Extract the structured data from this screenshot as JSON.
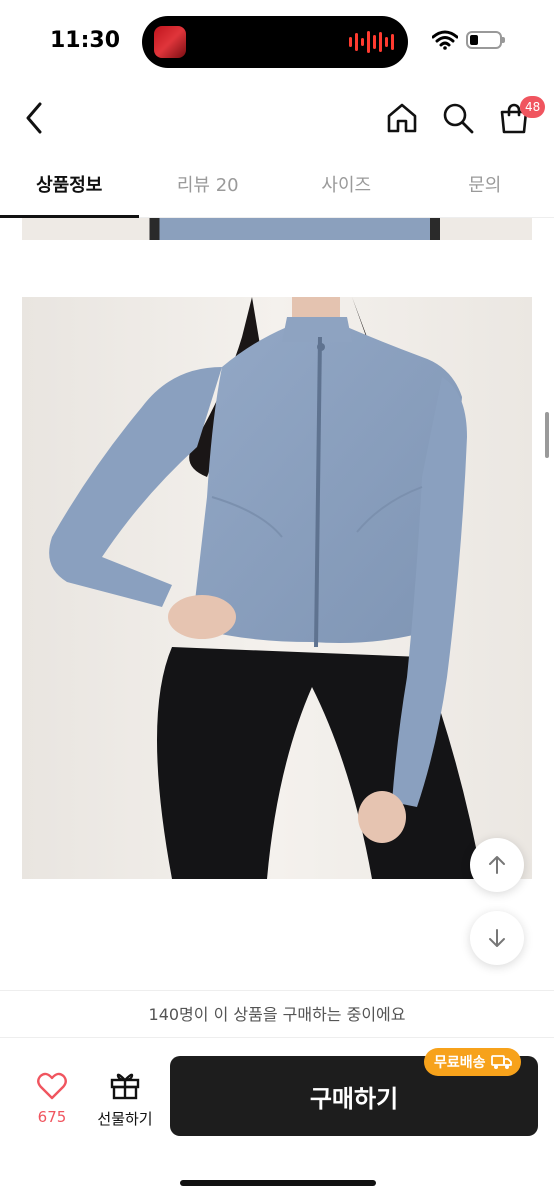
{
  "status_bar": {
    "time": "11:30",
    "icons": [
      "now-playing-artwork",
      "audio-wave-icon",
      "wifi-icon",
      "battery-icon"
    ]
  },
  "nav": {
    "icons": [
      "back-chevron-icon",
      "home-icon",
      "search-icon",
      "shopping-bag-icon"
    ],
    "cart_count": "48"
  },
  "tabs": [
    {
      "label": "상품정보",
      "active": true
    },
    {
      "label": "리뷰 20",
      "active": false
    },
    {
      "label": "사이즈",
      "active": false
    },
    {
      "label": "문의",
      "active": false
    }
  ],
  "floating": {
    "icons": [
      "arrow-up-icon",
      "arrow-down-icon"
    ]
  },
  "purchase_notice": "140명이 이 상품을 구매하는 중이에요",
  "bottom_bar": {
    "like_count": "675",
    "gift_label": "선물하기",
    "buy_label": "구매하기",
    "free_shipping_label": "무료배송"
  },
  "colors": {
    "accent_pink": "#f0555f",
    "shipping_orange": "#f7a21b",
    "buy_button": "#1d1d1d"
  }
}
